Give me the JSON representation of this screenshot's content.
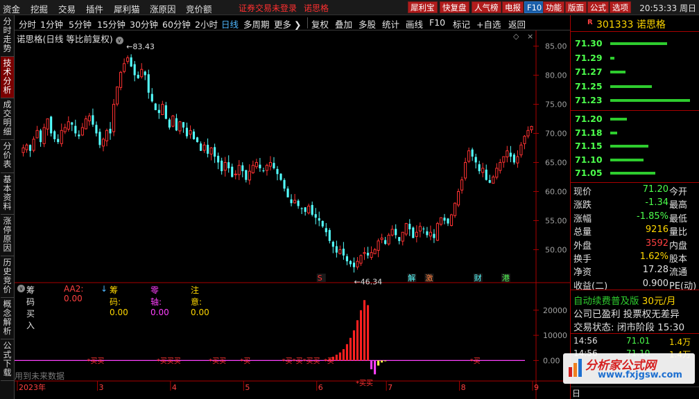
{
  "menu": {
    "items": [
      "资金",
      "挖掘",
      "交易",
      "插件",
      "犀利猫",
      "涨原因",
      "竞价额"
    ],
    "login_text": "证券交易未登录",
    "user_name": "诺思格",
    "right_buttons": [
      "犀利宝",
      "快复盘",
      "人气榜",
      "电报",
      "F10",
      "功能",
      "版面",
      "公式",
      "选项"
    ],
    "clock": "20:53:33 周日"
  },
  "left_tabs": [
    "分时走势",
    "技术分析",
    "成交明细",
    "分价表",
    "基本资料",
    "涨停原因",
    "历史竞价",
    "概念解析",
    "公式下载"
  ],
  "toolbar": {
    "items": [
      "分时",
      "1分钟",
      "5分钟",
      "15分钟",
      "30分钟",
      "60分钟",
      "2小时",
      "日线",
      "多周期",
      "更多"
    ],
    "tools": [
      "复权",
      "叠加",
      "多股",
      "统计",
      "画线",
      "F10",
      "标记",
      "+自选",
      "返回"
    ],
    "selected": "日线"
  },
  "chart_title": "诺思格(日线 等比前复权)",
  "sub_indicator": {
    "name": "筹码买入",
    "aa2_label": "AA2: 0.00",
    "chouma_label": "筹码: 0.00",
    "linghou_label": "零轴: 0.00",
    "zhuyi_label": "注意: 0.00",
    "future_note": "用到未来数据"
  },
  "chart_data": [
    {
      "type": "candlestick",
      "title": "诺思格(日线 等比前复权)",
      "y_ticks": [
        85.0,
        80.0,
        75.0,
        70.0,
        65.0,
        60.0,
        55.0,
        50.0
      ],
      "ylim": [
        46.0,
        86.5
      ],
      "x_labels": [
        "2023年",
        "3",
        "4",
        "5",
        "6",
        "7",
        "8",
        "9"
      ],
      "high_label": "83.43",
      "low_label": "46.34",
      "event_markers": [
        "S",
        "解",
        "激",
        "财",
        "港"
      ],
      "close_series": [
        67.5,
        68.0,
        67.0,
        69.0,
        70.5,
        68.5,
        71.0,
        72.5,
        70.0,
        69.0,
        68.5,
        70.5,
        71.0,
        72.0,
        71.5,
        70.0,
        69.5,
        71.0,
        72.5,
        73.0,
        71.5,
        70.0,
        68.0,
        69.0,
        70.5,
        70.0,
        75.0,
        78.0,
        80.5,
        82.0,
        83.0,
        81.5,
        80.0,
        79.5,
        81.0,
        80.0,
        77.0,
        75.5,
        74.0,
        73.5,
        75.0,
        72.5,
        71.0,
        73.0,
        70.5,
        72.0,
        71.0,
        69.5,
        70.5,
        69.0,
        68.5,
        67.0,
        68.0,
        66.5,
        67.5,
        66.0,
        65.0,
        63.5,
        65.0,
        64.0,
        62.5,
        63.0,
        64.5,
        63.5,
        62.0,
        63.5,
        64.5,
        65.0,
        64.0,
        63.5,
        64.5,
        65.0,
        64.0,
        63.0,
        62.0,
        60.5,
        59.0,
        58.0,
        58.5,
        57.5,
        57.0,
        56.5,
        57.5,
        56.0,
        55.5,
        55.0,
        54.0,
        53.0,
        51.5,
        50.5,
        49.5,
        50.0,
        49.0,
        48.0,
        47.5,
        47.0,
        48.0,
        49.0,
        49.5,
        49.0,
        49.5,
        50.0,
        51.5,
        52.0,
        51.0,
        52.5,
        53.5,
        52.5,
        51.5,
        53.0,
        54.5,
        53.5,
        52.0,
        53.0,
        54.0,
        53.5,
        52.5,
        53.0,
        52.0,
        54.5,
        55.5,
        55.0,
        54.5,
        56.0,
        58.0,
        60.0,
        62.0,
        65.0,
        67.0,
        66.0,
        65.0,
        63.5,
        64.0,
        62.0,
        61.5,
        62.5,
        64.0,
        65.0,
        66.0,
        67.0,
        66.0,
        65.0,
        66.0,
        68.0,
        69.5,
        70.5,
        71.2
      ],
      "_comment": "Approximate daily close prices read from the candlestick chart"
    },
    {
      "type": "bar",
      "title": "筹码买入",
      "y_ticks": [
        20000,
        10000,
        0.0
      ],
      "ylim": [
        -6500,
        26000
      ],
      "values": [
        0,
        0,
        0,
        0,
        0,
        0,
        0,
        0,
        0,
        0,
        0,
        0,
        0,
        0,
        0,
        0,
        0,
        0,
        0,
        0,
        0,
        0,
        0,
        0,
        0,
        0,
        0,
        0,
        0,
        0,
        0,
        0,
        0,
        0,
        0,
        0,
        0,
        0,
        0,
        0,
        0,
        0,
        0,
        0,
        0,
        0,
        0,
        0,
        0,
        0,
        0,
        0,
        0,
        0,
        0,
        0,
        0,
        0,
        0,
        0,
        0,
        0,
        0,
        0,
        0,
        0,
        0,
        0,
        0,
        0,
        0,
        0,
        0,
        0,
        0,
        0,
        0,
        0,
        0,
        0,
        0,
        0,
        0,
        0,
        0,
        0,
        0,
        300,
        800,
        1500,
        2300,
        3200,
        4500,
        6500,
        9000,
        12000,
        16000,
        20000,
        24000,
        22000,
        -3500,
        -5500,
        -2000,
        -800,
        -300,
        0,
        0,
        0,
        0,
        0,
        0,
        0,
        0,
        0,
        0,
        0,
        0,
        0,
        0,
        0,
        0,
        0,
        0,
        0,
        0,
        0,
        0,
        0,
        0,
        0,
        0,
        0,
        0,
        0,
        0,
        0,
        0,
        0,
        0,
        0,
        0,
        0,
        0,
        0,
        0,
        0,
        0,
        0,
        0,
        0,
        0,
        0
      ],
      "buy_labels": [
        "*买买",
        "*买买买",
        "*买买",
        "*买",
        "*买*买*买买",
        "*买",
        "*买"
      ],
      "lower_label": "*买买"
    }
  ],
  "stock": {
    "code": "301333",
    "name": "诺思格",
    "flag": "R"
  },
  "order_book": {
    "asks": [
      {
        "price": "71.30",
        "vol": 82
      },
      {
        "price": "71.29",
        "vol": 6
      },
      {
        "price": "71.27",
        "vol": 22
      },
      {
        "price": "71.25",
        "vol": 60
      },
      {
        "price": "71.23",
        "vol": 115
      }
    ],
    "bids": [
      {
        "price": "71.20",
        "vol": 24
      },
      {
        "price": "71.18",
        "vol": 10
      },
      {
        "price": "71.15",
        "vol": 55
      },
      {
        "price": "71.10",
        "vol": 48
      },
      {
        "price": "71.05",
        "vol": 65
      }
    ]
  },
  "quote": [
    {
      "label": "现价",
      "value": "71.20",
      "color": "#4cff4c",
      "label2": "今开"
    },
    {
      "label": "涨跌",
      "value": "-1.34",
      "color": "#4cff4c",
      "label2": "最高"
    },
    {
      "label": "涨幅",
      "value": "-1.85%",
      "color": "#4cff4c",
      "label2": "最低"
    },
    {
      "label": "总量",
      "value": "9216",
      "color": "#ffd700",
      "label2": "量比"
    },
    {
      "label": "外盘",
      "value": "3592",
      "color": "#ff4040",
      "label2": "内盘"
    },
    {
      "label": "换手",
      "value": "1.62%",
      "color": "#ffd700",
      "label2": "股本"
    },
    {
      "label": "净资",
      "value": "17.28",
      "color": "#e0e0e0",
      "label2": "流通"
    },
    {
      "label": "收益(二)",
      "value": "0.900",
      "color": "#e0e0e0",
      "label2": "PE(动)"
    }
  ],
  "ad": {
    "line1": "自动续费普及版",
    "price": "30元/月",
    "line2": "公司已盈利 投票权无差异",
    "line3": "交易状态: 闭市阶段",
    "line3_time": "15:30"
  },
  "ticks": [
    {
      "time": "14:56",
      "price": "71.01",
      "vol": "1.4万"
    },
    {
      "time": "14:56",
      "price": "71.10",
      "vol": "1.4万"
    }
  ],
  "watermark": {
    "title": "分析家公式网",
    "url": "www.fxjgsw.com"
  },
  "bottom_right_label": "日"
}
